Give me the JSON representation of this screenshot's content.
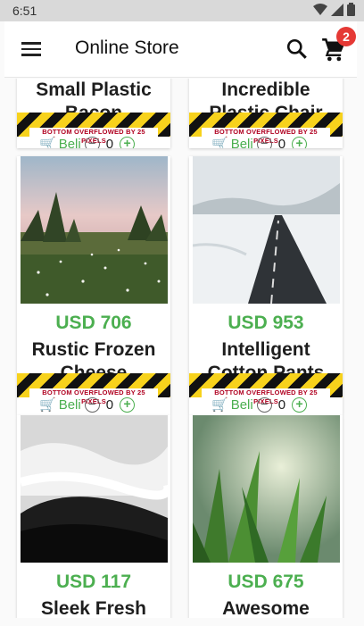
{
  "status": {
    "time": "6:51"
  },
  "app_bar": {
    "title": "Online Store",
    "cart_count": "2"
  },
  "overflow_message": "BOTTOM OVERFLOWED BY 25 PIXELS",
  "products": [
    {
      "name": "Small Plastic Bacon",
      "price": "",
      "buy_label": "Beli",
      "qty": "0",
      "image": ""
    },
    {
      "name": "Incredible Plastic Chair",
      "price": "",
      "buy_label": "Beli",
      "qty": "0",
      "image": ""
    },
    {
      "name": "Rustic Frozen Cheese",
      "price": "USD 706",
      "buy_label": "Beli",
      "qty": "0",
      "image": "meadow-photo"
    },
    {
      "name": "Intelligent Cotton Pants",
      "price": "USD 953",
      "buy_label": "Beli",
      "qty": "0",
      "image": "snowy-road-photo"
    },
    {
      "name": "Sleek Fresh",
      "price": "USD 117",
      "buy_label": "",
      "qty": "",
      "image": "foggy-hills-photo"
    },
    {
      "name": "Awesome",
      "price": "USD 675",
      "buy_label": "",
      "qty": "",
      "image": "grass-photo"
    }
  ],
  "colors": {
    "price_green": "#4caf50",
    "badge_red": "#e53935",
    "stripe_yellow": "#f7d21c"
  }
}
